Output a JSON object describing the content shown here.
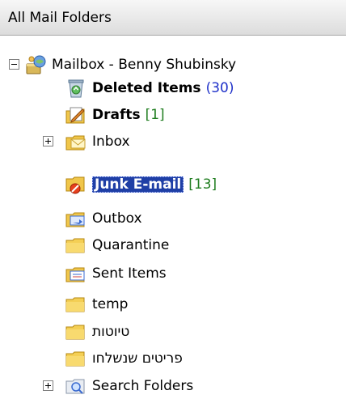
{
  "header": {
    "title": "All Mail Folders"
  },
  "tree": {
    "root": {
      "label": "Mailbox - Benny Shubinsky",
      "icon": "mailbox-icon"
    },
    "folders": [
      {
        "label": "Deleted Items",
        "count": "(30)",
        "icon": "deleted-items-icon"
      },
      {
        "label": "Drafts",
        "count": "[1]",
        "icon": "drafts-icon"
      },
      {
        "label": "Inbox",
        "icon": "inbox-icon"
      },
      {
        "label": "Junk E-mail",
        "count": "[13]",
        "icon": "junk-email-icon"
      },
      {
        "label": "Outbox",
        "icon": "outbox-icon"
      },
      {
        "label": "Quarantine",
        "icon": "folder-icon"
      },
      {
        "label": "Sent Items",
        "icon": "sent-items-icon"
      },
      {
        "label": "temp",
        "icon": "folder-icon"
      },
      {
        "label": "טיוטות",
        "icon": "folder-icon"
      },
      {
        "label": "פריטים שנשלחו",
        "icon": "folder-icon"
      },
      {
        "label": "Search Folders",
        "icon": "search-folders-icon"
      }
    ]
  },
  "colors": {
    "selection": "#1f3fa6",
    "count_blue": "#1f31c9",
    "count_green": "#1f7d1f"
  }
}
